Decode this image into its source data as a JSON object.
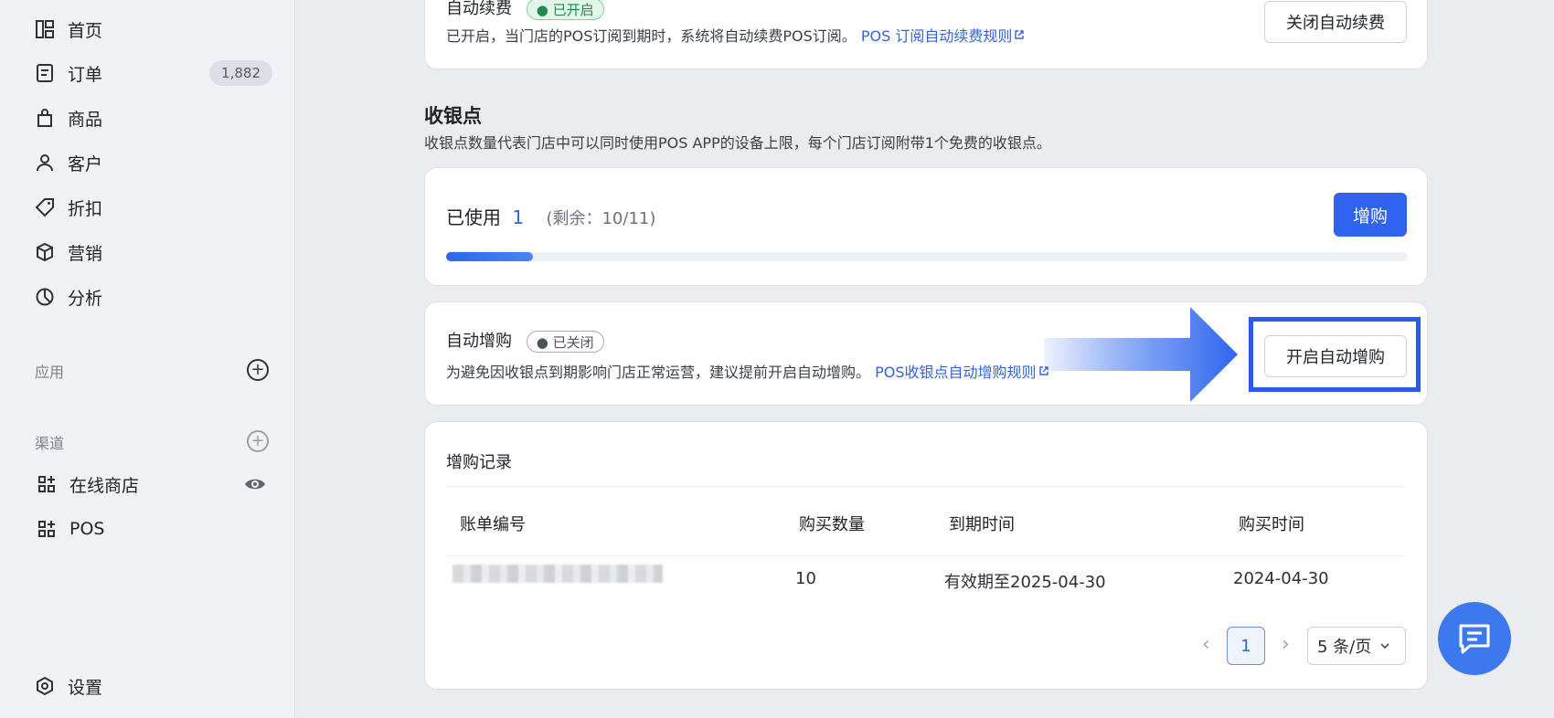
{
  "sidebar": {
    "items": [
      {
        "label": "首页",
        "icon": "dashboard-icon"
      },
      {
        "label": "订单",
        "icon": "order-icon",
        "badge": "1,882"
      },
      {
        "label": "商品",
        "icon": "bag-icon"
      },
      {
        "label": "客户",
        "icon": "user-icon"
      },
      {
        "label": "折扣",
        "icon": "tag-icon"
      },
      {
        "label": "营销",
        "icon": "cube-icon"
      },
      {
        "label": "分析",
        "icon": "pie-chart-icon"
      }
    ],
    "apps_label": "应用",
    "channels_label": "渠道",
    "channels": [
      {
        "label": "在线商店"
      },
      {
        "label": "POS"
      }
    ],
    "settings_label": "设置"
  },
  "auto_renew": {
    "title": "自动续费",
    "status": "● 已开启",
    "desc": "已开启，当门店的POS订阅到期时，系统将自动续费POS订阅。",
    "link": "POS 订阅自动续费规则",
    "button": "关闭自动续费"
  },
  "cashier": {
    "title": "收银点",
    "desc": "收银点数量代表门店中可以同时使用POS APP的设备上限，每个门店订阅附带1个免费的收银点。",
    "used_label": "已使用",
    "used_value": "1",
    "remaining": "(剩余：10/11)",
    "buy_button": "增购",
    "progress_fraction": 0.09
  },
  "auto_buy": {
    "title": "自动增购",
    "status": "● 已关闭",
    "desc": "为避免因收银点到期影响门店正常运营，建议提前开启自动增购。",
    "link": "POS收银点自动增购规则",
    "button": "开启自动增购"
  },
  "records": {
    "title": "增购记录",
    "columns": [
      "账单编号",
      "购买数量",
      "到期时间",
      "购买时间"
    ],
    "rows": [
      {
        "quantity": "10",
        "expires": "有效期至2025-04-30",
        "purchased": "2024-04-30"
      }
    ],
    "page": "1",
    "page_size": "5 条/页"
  },
  "colors": {
    "primary": "#2f64ef",
    "success": "#1e8a4c",
    "chat": "#3c78ee"
  }
}
